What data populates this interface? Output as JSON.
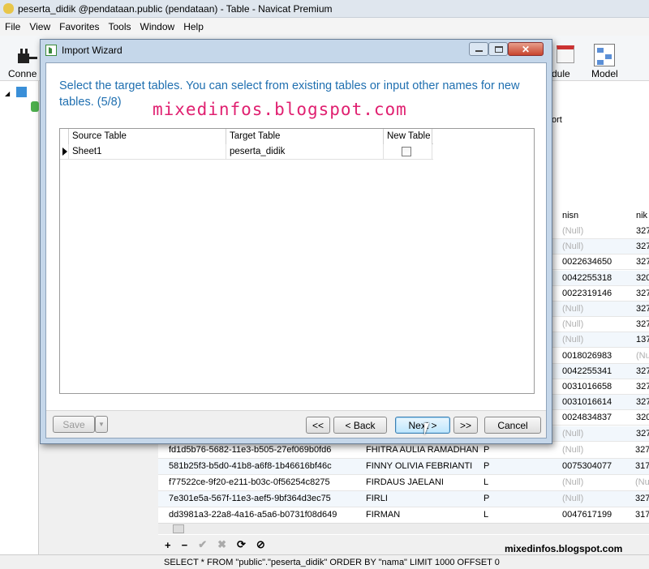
{
  "window": {
    "title": "peserta_didik @pendataan.public (pendataan) - Table - Navicat Premium"
  },
  "menu": [
    "File",
    "View",
    "Favorites",
    "Tools",
    "Window",
    "Help"
  ],
  "toolbar": {
    "left_label": "Conne",
    "module_label": "dule",
    "model_label": "Model"
  },
  "tab_fragment": "ort",
  "grid": {
    "headers": {
      "nisn": "nisn",
      "nik": "nik"
    },
    "right_rows": [
      [
        "(Null)",
        "327"
      ],
      [
        "(Null)",
        "327"
      ],
      [
        "0022634650",
        "327"
      ],
      [
        "0042255318",
        "320"
      ],
      [
        "0022319146",
        "327"
      ],
      [
        "(Null)",
        "327"
      ],
      [
        "(Null)",
        "327"
      ],
      [
        "(Null)",
        "137"
      ],
      [
        "0018026983",
        "(Nu"
      ],
      [
        "0042255341",
        "327"
      ],
      [
        "0031016658",
        "327"
      ],
      [
        "0031016614",
        "327"
      ],
      [
        "0024834837",
        "320"
      ],
      [
        "(Null)",
        "327"
      ]
    ],
    "rows": [
      {
        "id": "fd1d5b76-5682-11e3-b505-27ef069b0fd6",
        "nama": "FHITRA AULIA RAMADHAN",
        "jk": "P",
        "nisn": "(Null)",
        "nik": "327"
      },
      {
        "id": "581b25f3-b5d0-41b8-a6f8-1b46616bf46c",
        "nama": "FINNY OLIVIA FEBRIANTI",
        "jk": "P",
        "nisn": "0075304077",
        "nik": "317"
      },
      {
        "id": "f77522ce-9f20-e211-b03c-0f56254c8275",
        "nama": "FIRDAUS JAELANI",
        "jk": "L",
        "nisn": "(Null)",
        "nik": "(Nu"
      },
      {
        "id": "7e301e5a-567f-11e3-aef5-9bf364d3ec75",
        "nama": "FIRLI",
        "jk": "P",
        "nisn": "(Null)",
        "nik": "327"
      },
      {
        "id": "dd3981a3-22a8-4a16-a5a6-b0731f08d649",
        "nama": "FIRMAN",
        "jk": "L",
        "nisn": "0047617199",
        "nik": "317"
      }
    ]
  },
  "bottom_toolbar_icons": [
    "+",
    "−",
    "✔",
    "✖",
    "⟳",
    "⊘"
  ],
  "status": "SELECT * FROM \"public\".\"peserta_didik\" ORDER BY \"nama\" LIMIT 1000 OFFSET 0",
  "watermark": {
    "top": "mixedinfos.blogspot.com",
    "bottom": "mixedinfos.blogspot.com"
  },
  "dialog": {
    "title": "Import Wizard",
    "heading": "Select the target tables. You can select from existing tables or input other names for new tables. (5/8)",
    "columns": [
      "Source Table",
      "Target Table",
      "New Table"
    ],
    "rows": [
      {
        "source": "Sheet1",
        "target": "peserta_didik",
        "new_table": false
      }
    ],
    "buttons": {
      "save": "Save",
      "first": "<<",
      "back": "< Back",
      "next": "Next >",
      "last": ">>",
      "cancel": "Cancel"
    }
  }
}
